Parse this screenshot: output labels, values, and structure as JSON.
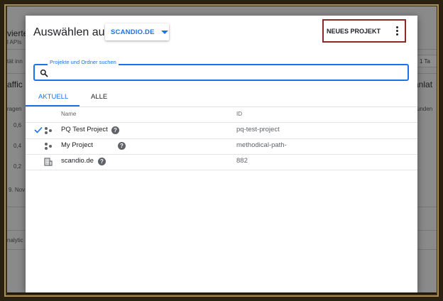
{
  "background": {
    "heading_left": "vierte",
    "sub_left": "l APIs",
    "label_left_row": "tät inn",
    "chart_heading": "affic",
    "chart_sub": "ragen",
    "y_values": [
      "0,6",
      "0,4",
      "0,2"
    ],
    "date_label": "9. Nov",
    "footer_label": "nalytic",
    "right_box": "1 Ta",
    "right_heading": "anlat",
    "right_sub": "unden"
  },
  "dialog": {
    "title": "Auswählen aus",
    "org_selector": "SCANDIO.DE",
    "new_project_label": "NEUES PROJEKT",
    "search_label": "Projekte und Ordner suchen",
    "search_value": "",
    "tabs": [
      {
        "label": "AKTUELL",
        "active": true
      },
      {
        "label": "ALLE",
        "active": false
      }
    ],
    "columns": {
      "name": "Name",
      "id": "ID"
    },
    "rows": [
      {
        "name": "PQ Test Project",
        "id": "pq-test-project",
        "selected": true,
        "kind": "project",
        "help": true
      },
      {
        "name": "My Project",
        "id": "methodical-path-",
        "selected": false,
        "kind": "project",
        "help": true
      },
      {
        "name": "scandio.de",
        "id": "882",
        "selected": false,
        "kind": "organization",
        "help": true
      }
    ]
  },
  "colors": {
    "accent": "#1a73e8",
    "highlight_border": "#8b2a22"
  },
  "icons": [
    "search-icon",
    "caret-down-icon",
    "more-vert-icon",
    "check-icon",
    "project-icon",
    "organization-icon",
    "help-icon"
  ]
}
